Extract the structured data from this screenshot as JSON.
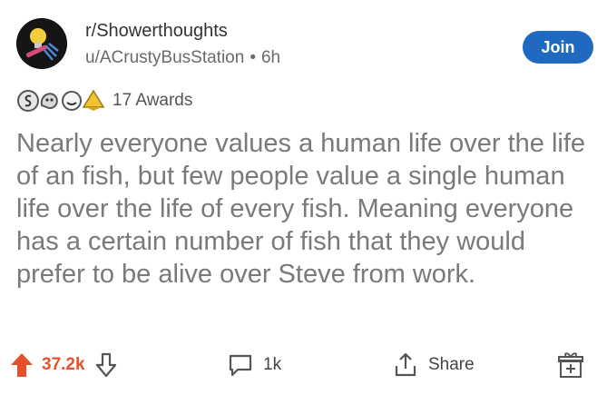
{
  "post": {
    "subreddit": "r/Showerthoughts",
    "author": "u/ACrustyBusStation",
    "separator": "•",
    "age": "6h",
    "join_label": "Join",
    "awards_label": "17 Awards",
    "title": "Nearly everyone values a human life over the life of an fish, but few people value a single human life over the life of every fish. Meaning everyone has a certain number of fish that they would prefer to be alive over Steve from work."
  },
  "actions": {
    "upvotes": "37.2k",
    "comments": "1k",
    "share_label": "Share"
  },
  "colors": {
    "join": "#1f6ac0",
    "upvote": "#e4512b"
  },
  "icons": [
    "subreddit-icon",
    "award-silver-icon",
    "award-wholesome-icon",
    "award-helpful-icon",
    "award-gold-icon",
    "upvote-icon",
    "downvote-icon",
    "comment-icon",
    "share-icon",
    "gift-award-icon"
  ]
}
